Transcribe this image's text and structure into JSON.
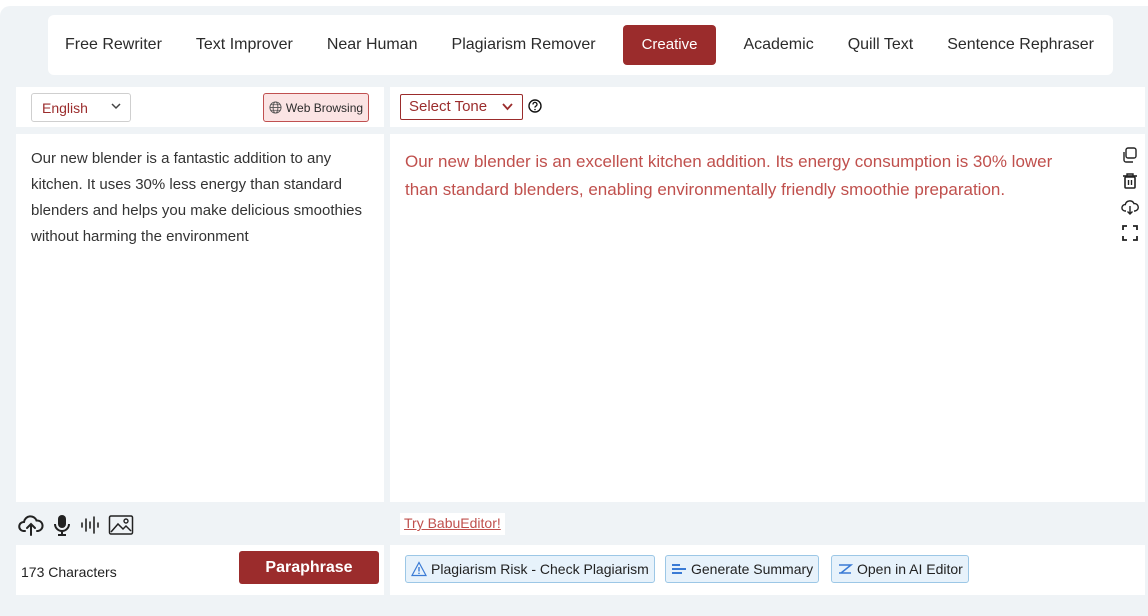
{
  "modes": [
    {
      "label": "Free Rewriter",
      "active": false
    },
    {
      "label": "Text Improver",
      "active": false
    },
    {
      "label": "Near Human",
      "active": false
    },
    {
      "label": "Plagiarism Remover",
      "active": false
    },
    {
      "label": "Creative",
      "active": true
    },
    {
      "label": "Academic",
      "active": false
    },
    {
      "label": "Quill Text",
      "active": false
    },
    {
      "label": "Sentence Rephraser",
      "active": false
    }
  ],
  "input": {
    "language": "English",
    "web_browsing_label": "Web Browsing",
    "text": "Our new blender is a fantastic addition to any kitchen. It uses 30% less energy than standard blenders and helps you make delicious smoothies without harming the environment",
    "char_count": "173 Characters",
    "paraphrase_label": "Paraphrase"
  },
  "output": {
    "tone_label": "Select Tone",
    "text": "Our new blender is an excellent kitchen addition. Its energy consumption is 30% lower than standard blenders, enabling environmentally friendly smoothie preparation.",
    "try_link": "Try BabuEditor!",
    "actions": {
      "plagiarism": "Plagiarism Risk - Check Plagiarism",
      "summary": "Generate Summary",
      "ai_editor": "Open in AI Editor"
    }
  },
  "colors": {
    "brand": "#9b2c2c",
    "output_text": "#c0504d",
    "chip_bg": "#e7f2fb",
    "panel_bg": "#eff3f6"
  }
}
